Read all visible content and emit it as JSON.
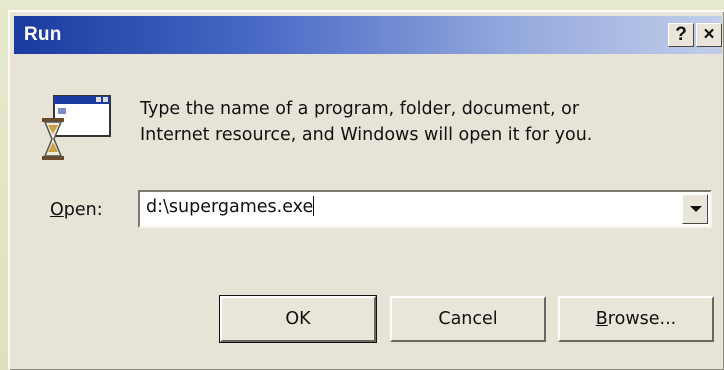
{
  "window": {
    "title": "Run",
    "help_label": "?",
    "close_label": "×"
  },
  "dialog": {
    "icon": "run-program-icon",
    "description_line1": "Type the name of a program, folder, document, or",
    "description_line2": "Internet resource, and Windows will open it for you.",
    "open_label_underlined": "O",
    "open_label_rest": "pen:",
    "open_value": "d:\\supergames.exe"
  },
  "buttons": {
    "ok_label": "OK",
    "cancel_label": "Cancel",
    "browse_underlined": "B",
    "browse_rest": "rowse..."
  },
  "colors": {
    "titlebar_start": "#1a3aa0",
    "titlebar_end": "#c2cdea",
    "dialog_face": "#e7e3d6"
  }
}
